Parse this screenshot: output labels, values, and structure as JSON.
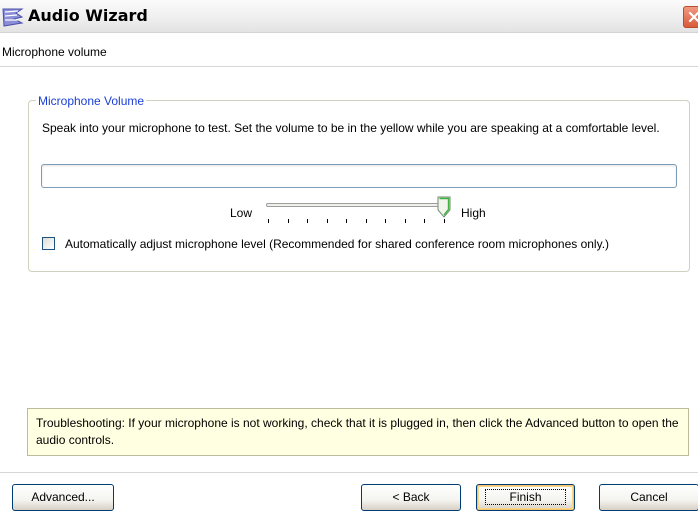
{
  "window": {
    "title": "Audio Wizard",
    "app_icon": "audio-wizard-icon",
    "close_icon": "close-icon"
  },
  "page": {
    "heading": "Microphone volume"
  },
  "group": {
    "legend": "Microphone Volume",
    "instructions": "Speak into your microphone to test. Set the volume to be in the yellow while you are speaking at a comfortable level.",
    "level_meter_fill": 0,
    "slider": {
      "low_label": "Low",
      "high_label": "High",
      "value_fraction": 1.0,
      "tick_count": 10
    },
    "auto_adjust": {
      "label": "Automatically adjust microphone level (Recommended for shared conference room microphones only.)",
      "checked": false
    }
  },
  "troubleshooting": {
    "text": "Troubleshooting: If your microphone is not working, check that it is plugged in, then click the Advanced button to open the audio controls."
  },
  "buttons": {
    "advanced": "Advanced...",
    "back": "< Back",
    "finish": "Finish",
    "cancel": "Cancel"
  },
  "colors": {
    "legend": "#1a3ed6",
    "troubleshooting_bg": "#ffffe1",
    "close_button": "#d85a3a"
  }
}
